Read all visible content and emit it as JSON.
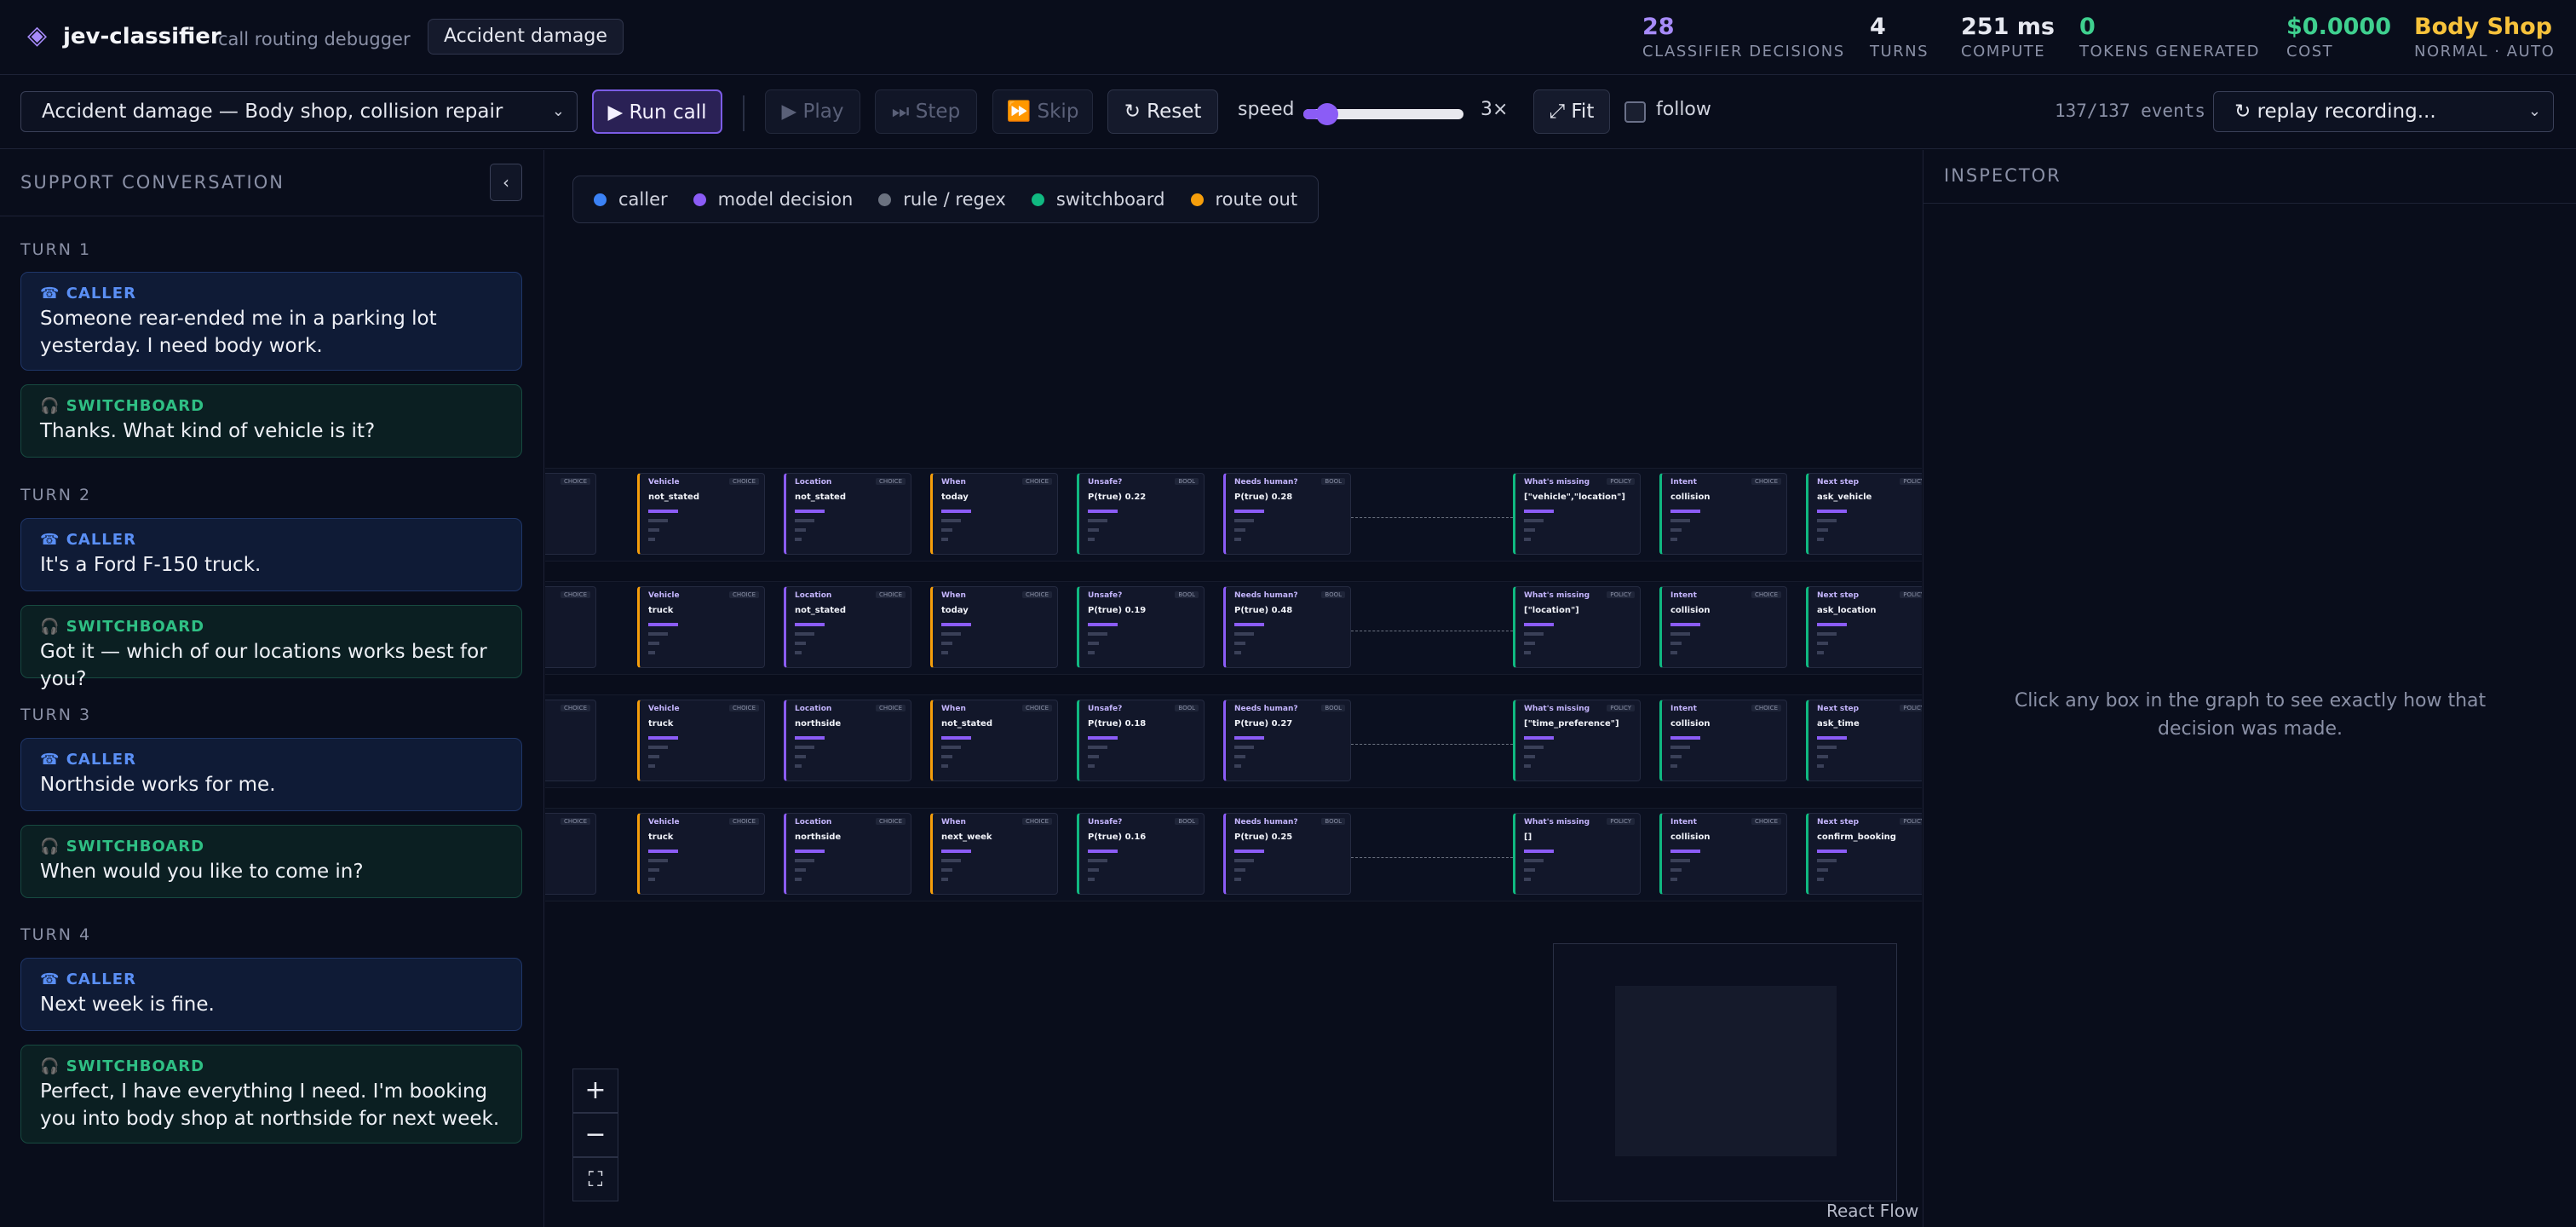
{
  "app": {
    "title": "jev-classifier",
    "subtitle": "call routing debugger",
    "case": "Accident damage"
  },
  "stats": [
    {
      "value": "28",
      "label": "CLASSIFIER DECISIONS",
      "color": "#a78bfa"
    },
    {
      "value": "4",
      "label": "TURNS",
      "color": "#f3f4f8"
    },
    {
      "value": "251 ms",
      "label": "COMPUTE",
      "color": "#f3f4f8"
    },
    {
      "value": "0",
      "label": "TOKENS GENERATED",
      "color": "#3fd08f"
    },
    {
      "value": "$0.0000",
      "label": "COST",
      "color": "#3fd08f"
    },
    {
      "value": "Body Shop",
      "label": "NORMAL · AUTO",
      "color": "#f7c23b"
    }
  ],
  "toolbar": {
    "scenario": "Accident damage — Body shop, collision repair",
    "run": "▶ Run call",
    "play": "▶ Play",
    "step": "⏭ Step",
    "skip": "⏩ Skip",
    "reset": "↻ Reset",
    "speed_label": "speed",
    "speed_value": "3×",
    "speed_fraction": 0.1,
    "fit": "⤢ Fit",
    "follow": "follow",
    "events": "137/137 events",
    "replay": "↻ replay recording..."
  },
  "conversation": {
    "title": "SUPPORT CONVERSATION",
    "collapse": "‹",
    "turns": [
      {
        "label": "TURN 1",
        "caller": "Someone rear-ended me in a parking lot yesterday. I need body work.",
        "switchboard": "Thanks. What kind of vehicle is it?"
      },
      {
        "label": "TURN 2",
        "caller": "It's a Ford F-150 truck.",
        "switchboard": "Got it — which of our locations works best for you?"
      },
      {
        "label": "TURN 3",
        "caller": "Northside works for me.",
        "switchboard": "When would you like to come in?"
      },
      {
        "label": "TURN 4",
        "caller": "Next week is fine.",
        "switchboard": "Perfect, I have everything I need. I'm booking you into body shop at northside for next week."
      }
    ],
    "caller_label": "☎ CALLER",
    "switchboard_label": "🎧 SWITCHBOARD"
  },
  "legend": [
    {
      "label": "caller",
      "color": "#3b82f6"
    },
    {
      "label": "model decision",
      "color": "#8b5cf6"
    },
    {
      "label": "rule / regex",
      "color": "#6b7280"
    },
    {
      "label": "switchboard",
      "color": "#10b981"
    },
    {
      "label": "route out",
      "color": "#f59e0b"
    }
  ],
  "graph": {
    "rows": [
      {
        "vehicle": "not_stated",
        "location": "not_stated",
        "when": "today",
        "unsafe": "P(true) 0.22",
        "human": "P(true) 0.28",
        "missing": "[\"vehicle\",\"location\"]",
        "intent": "collision",
        "next": "ask_vehicle"
      },
      {
        "vehicle": "truck",
        "location": "not_stated",
        "when": "today",
        "unsafe": "P(true) 0.19",
        "human": "P(true) 0.48",
        "missing": "[\"location\"]",
        "intent": "collision",
        "next": "ask_location"
      },
      {
        "vehicle": "truck",
        "location": "northside",
        "when": "not_stated",
        "unsafe": "P(true) 0.18",
        "human": "P(true) 0.27",
        "missing": "[\"time_preference\"]",
        "intent": "collision",
        "next": "ask_time"
      },
      {
        "vehicle": "truck",
        "location": "northside",
        "when": "next_week",
        "unsafe": "P(true) 0.16",
        "human": "P(true) 0.25",
        "missing": "[]",
        "intent": "collision",
        "next": "confirm_booking"
      }
    ],
    "node_titles": {
      "vehicle": "Vehicle",
      "location": "Location",
      "when": "When",
      "unsafe": "Unsafe?",
      "human": "Needs human?",
      "missing": "What's missing",
      "intent": "Intent",
      "next": "Next step"
    },
    "tags": {
      "choice": "CHOICE",
      "bool": "BOOL",
      "policy": "POLICY"
    }
  },
  "controls": {
    "zoom_in": "+",
    "zoom_out": "−",
    "fullscreen": "⛶",
    "attribution": "React Flow"
  },
  "inspector": {
    "title": "INSPECTOR",
    "hint": "Click any box in the graph to see exactly how that decision was made."
  }
}
